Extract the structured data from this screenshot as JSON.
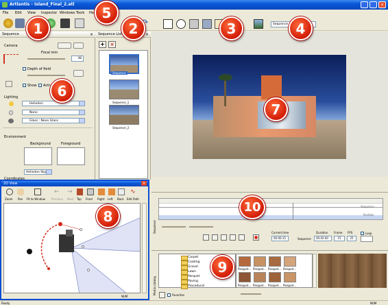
{
  "window": {
    "title": "Artlantis - Island_Final_2.atl"
  },
  "menu": [
    "File",
    "Edit",
    "View",
    "Inspector",
    "Windows",
    "Tools",
    "Help"
  ],
  "toolbar": {
    "sequence_select": "Sequence"
  },
  "inspector": {
    "title": "Sequence",
    "camera_label": "Camera",
    "focal_label": "Focal mm",
    "focal_value": "38",
    "depth_of_field": "Depth of field",
    "show": "Show",
    "active": "Active",
    "lighting_label": "Lighting",
    "lighting_options": [
      "Heliodon",
      "None",
      "Glass : Neon Glass"
    ],
    "environment_label": "Environment",
    "background_label": "Background",
    "foreground_label": "Foreground",
    "env_select": "Heliodon Sky",
    "coordinates_label": "Coordinates"
  },
  "sequence_list": {
    "title": "Sequence List",
    "items": [
      "Sequence",
      "Sequence_1",
      "Sequence_2"
    ]
  },
  "view2d": {
    "title": "2D View",
    "tools": [
      "Zoom",
      "Pan",
      "Fit to Window",
      "Previous",
      "Next",
      "Top",
      "Front",
      "Right",
      "Left",
      "Back",
      "Edit Path"
    ],
    "status": "NUM"
  },
  "timeline": {
    "track_labels": [
      "Sequence",
      "Position"
    ],
    "side_label": "Sequence",
    "current_time_label": "Current time",
    "current_time": "00:00:15",
    "duration_label": "Duration",
    "duration": "00:02:00",
    "frame_label": "Frame",
    "frame": "15",
    "fps_label": "FPS",
    "fps": "25",
    "loop_label": "Loop",
    "sequence_word": "Sequence"
  },
  "media_catalog": {
    "side_label": "Media catalog",
    "folders": [
      "Carpet",
      "Coating",
      "Gravel",
      "Lawn",
      "Parquet",
      "Paving",
      "Procedural"
    ],
    "material_label": "Parquet...",
    "favorites": "Favorites"
  },
  "status_bar": {
    "left": "Ready",
    "right": "NUM"
  },
  "badges": [
    "1",
    "2",
    "3",
    "4",
    "5",
    "6",
    "7",
    "8",
    "9",
    "10"
  ]
}
